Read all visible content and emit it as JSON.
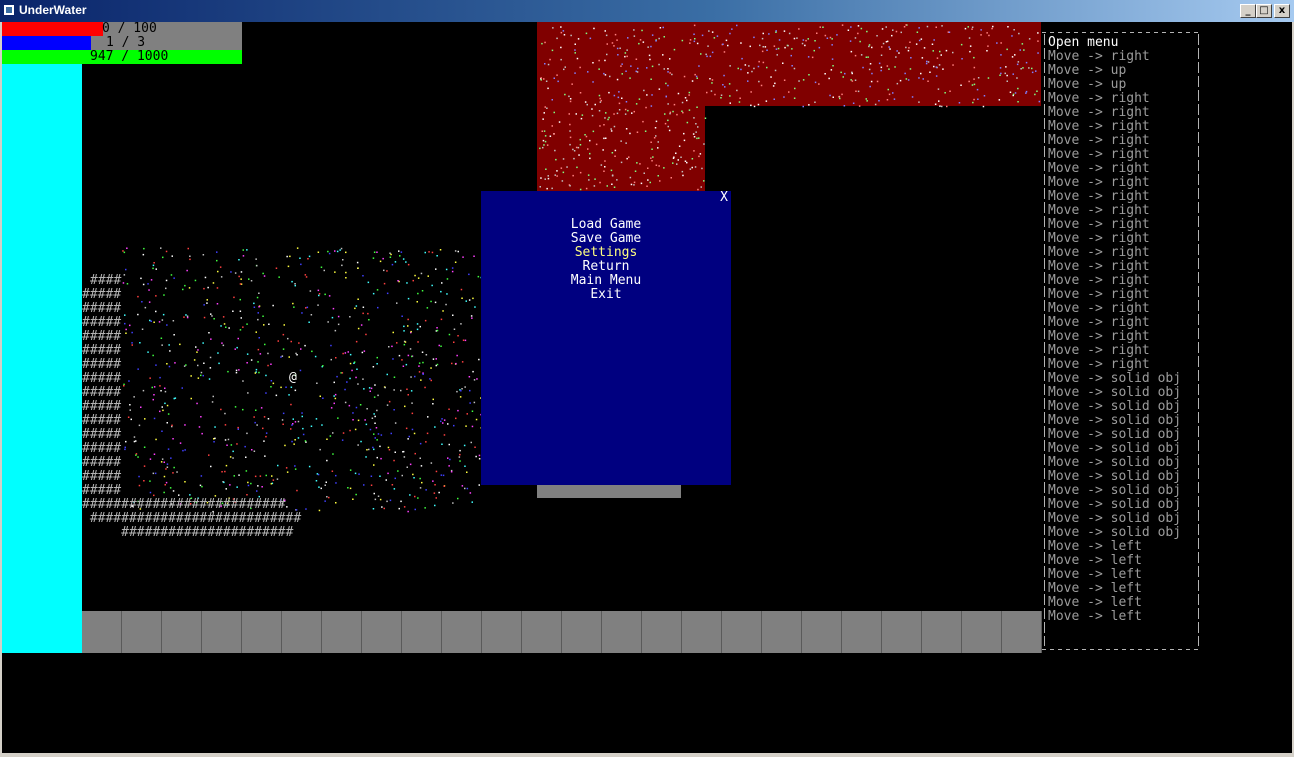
{
  "window": {
    "title": "UnderWater",
    "minimize": "_",
    "maximize": "□",
    "close": "x"
  },
  "hud": {
    "health": {
      "text": "0 / 100",
      "value": 0,
      "max": 100,
      "fill_fraction": 0.42,
      "color": "#ff0000"
    },
    "mana": {
      "text": "1 / 3",
      "value": 1,
      "max": 3,
      "fill_fraction": 0.37,
      "color": "#0000ff"
    },
    "oxygen": {
      "text": "947 / 1000",
      "value": 947,
      "max": 1000,
      "fill_fraction": 1.0,
      "color": "#00ff00"
    },
    "bar_bg_color": "#808080"
  },
  "map": {
    "player_glyph": "@",
    "wall_rows": [
      "####",
      "#####",
      "#####",
      "#####",
      "#####",
      "#####",
      "#####",
      "#####",
      "#####",
      "#####",
      "#####",
      "#####",
      "#####",
      "#####",
      "#####",
      "#####",
      "##########################",
      " ###########################",
      "     ######################"
    ],
    "colors": {
      "water": "#00ffff",
      "lava": "#800000",
      "floor": "#808080",
      "background": "#000000"
    }
  },
  "menu": {
    "close_label": "X",
    "items": [
      {
        "label": "Load Game"
      },
      {
        "label": "Save Game"
      },
      {
        "label": "Settings",
        "selected": true
      },
      {
        "label": "Return"
      },
      {
        "label": "Main Menu"
      },
      {
        "label": "Exit"
      }
    ],
    "background": "#000080"
  },
  "log": {
    "entries": [
      "Open menu",
      "Move -> right",
      "Move -> up",
      "Move -> up",
      "Move -> right",
      "Move -> right",
      "Move -> right",
      "Move -> right",
      "Move -> right",
      "Move -> right",
      "Move -> right",
      "Move -> right",
      "Move -> right",
      "Move -> right",
      "Move -> right",
      "Move -> right",
      "Move -> right",
      "Move -> right",
      "Move -> right",
      "Move -> right",
      "Move -> right",
      "Move -> right",
      "Move -> right",
      "Move -> right",
      "Move -> solid obj",
      "Move -> solid obj",
      "Move -> solid obj",
      "Move -> solid obj",
      "Move -> solid obj",
      "Move -> solid obj",
      "Move -> solid obj",
      "Move -> solid obj",
      "Move -> solid obj",
      "Move -> solid obj",
      "Move -> solid obj",
      "Move -> solid obj",
      "Move -> left",
      "Move -> left",
      "Move -> left",
      "Move -> left",
      "Move -> left",
      "Move -> left"
    ]
  }
}
